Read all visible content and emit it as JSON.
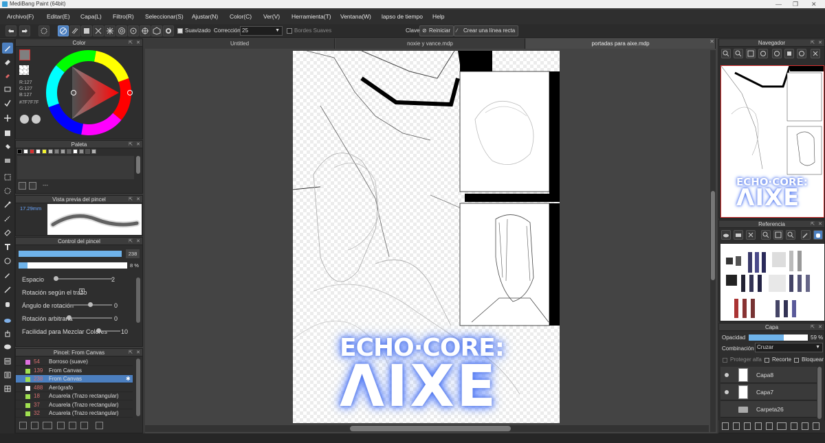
{
  "window": {
    "title": "MediBang Paint (64bit)",
    "controls": [
      "—",
      "❐",
      "✕"
    ]
  },
  "menu": {
    "items": [
      "Archivo(F)",
      "Editar(E)",
      "Capa(L)",
      "Filtro(R)",
      "Seleccionar(S)",
      "Ajustar(N)",
      "Color(C)",
      "Ver(V)",
      "Herramienta(T)",
      "Ventana(W)",
      "lapso de tiempo",
      "Help"
    ]
  },
  "toolbar": {
    "smoothing_label": "Suavizado",
    "correction_label": "Corrección",
    "correction_value": "25",
    "soft_edges_label": "Bordes Suaves",
    "key_label": "Clave",
    "reset_label": "Reiniciar",
    "straight_line_label": "Crear una línea recta"
  },
  "color_panel": {
    "title": "Color",
    "r": "R:127",
    "g": "G:127",
    "b": "B:127",
    "hex": "#7F7F7F"
  },
  "palette_panel": {
    "title": "Paleta",
    "footer_text": "---",
    "swatches": [
      "#000000",
      "#ffffff",
      "#d83030",
      "#ffffff",
      "#f4f430",
      "#c0c0c0",
      "#7f7f7f",
      "#a0a0a0",
      "#606060",
      "#ffffff",
      "#909090",
      "#505050",
      "#b0b0b0"
    ]
  },
  "brush_preview": {
    "title": "Vista previa del pincel",
    "size": "17.29mm"
  },
  "brush_control": {
    "title": "Control del pincel",
    "size_value": "238",
    "opacity_value": "8 %",
    "rows": [
      {
        "label": "Espacio",
        "value": "2"
      },
      {
        "label": "Rotación según el trazo",
        "value": "✕"
      },
      {
        "label": "Ángulo de rotación",
        "value": "0"
      },
      {
        "label": "Rotación arbitraria",
        "value": "0"
      },
      {
        "label": "Facilidad para Mezclar Colores",
        "value": "10"
      }
    ]
  },
  "brush_list": {
    "title": "Pincel: From Canvas",
    "items": [
      {
        "size": "54",
        "name": "Borroso (suave)",
        "color": "#e070e0"
      },
      {
        "size": "139",
        "name": "From Canvas",
        "color": "#a0e050"
      },
      {
        "size": "238",
        "name": "From Canvas",
        "color": "#a0e050"
      },
      {
        "size": "488",
        "name": "Aerógrafo",
        "color": "#ffffff"
      },
      {
        "size": "18",
        "name": "Acuarela (Trazo rectangular)",
        "color": "#a0e050"
      },
      {
        "size": "37",
        "name": "Acuarela (Trazo rectangular)",
        "color": "#a0e050"
      },
      {
        "size": "32",
        "name": "Acuarela (Trazo rectangular)",
        "color": "#a0e050"
      }
    ]
  },
  "tabs": [
    "Untitled",
    "noxie y vance.mdp",
    "portadas para aixe.mdp"
  ],
  "artwork": {
    "logo_line1": "ECHO·CORE:",
    "logo_line2": "ΛIXE"
  },
  "navigator": {
    "title": "Navegador",
    "logo_line1": "ECHO·CORE:",
    "logo_line2": "ΛIXE"
  },
  "reference": {
    "title": "Referencia"
  },
  "layer_panel": {
    "title": "Capa",
    "opacity_label": "Opacidad",
    "opacity_value": "59 %",
    "blend_label": "Combinación",
    "blend_value": "Cruzar",
    "protect_alpha": "Proteger alfa",
    "clipping": "Recorte",
    "lock": "Bloquear",
    "layers": [
      "Capa8",
      "Capa7",
      "Carpeta26"
    ]
  },
  "colors": {
    "accent": "#4c7fbf",
    "foreground": "#7f7f7f"
  }
}
